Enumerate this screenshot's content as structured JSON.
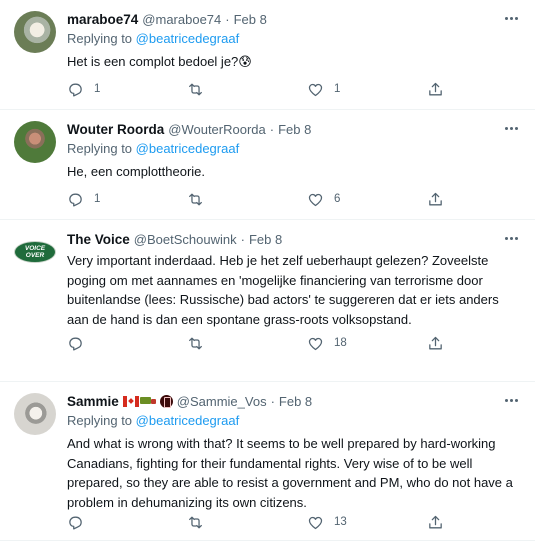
{
  "tweets": [
    {
      "name": "maraboe74",
      "handle": "@maraboe74",
      "date": "Feb 8",
      "replying_prefix": "Replying to ",
      "replying_to": "@beatricedegraaf",
      "text": "Het is een complot bedoel je?😰",
      "replies": "1",
      "retweets": "",
      "likes": "1"
    },
    {
      "name": "Wouter Roorda",
      "handle": "@WouterRoorda",
      "date": "Feb 8",
      "replying_prefix": "Replying to ",
      "replying_to": "@beatricedegraaf",
      "text": "He, een complottheorie.",
      "replies": "1",
      "retweets": "",
      "likes": "6"
    },
    {
      "name": "The Voice",
      "handle": "@BoetSchouwink",
      "date": "Feb 8",
      "avatar_text": "VOICE OVER",
      "replying_prefix": "",
      "replying_to": "",
      "text": "Very important inderdaad. Heb je het zelf ueberhaupt gelezen? Zoveelste poging om met aannames en 'mogelijke financiering van terrorisme door buitenlandse (lees: Russische) bad actors' te suggereren dat er iets anders aan de hand is dan een spontane grass-roots volksopstand.",
      "replies": "",
      "retweets": "",
      "likes": "18"
    },
    {
      "name": "Sammie",
      "handle": "@Sammie_Vos",
      "date": "Feb 8",
      "replying_prefix": "Replying to ",
      "replying_to": "@beatricedegraaf",
      "text": "And what is wrong with that? It seems to be well prepared by hard-working Canadians, fighting for their fundamental rights. Very wise of to be well prepared, so they are able to resist a government and PM, who do not have a problem in dehumanizing its own citizens.",
      "replies": "",
      "retweets": "",
      "likes": "13"
    }
  ],
  "separator": "·",
  "icons": {
    "reply": "reply-icon",
    "retweet": "retweet-icon",
    "like": "heart-icon",
    "share": "share-icon",
    "more": "more-icon"
  },
  "colors": {
    "link": "#1d9bf0",
    "secondary_text": "#536471",
    "primary_text": "#0f1419",
    "divider": "#eff3f4"
  }
}
